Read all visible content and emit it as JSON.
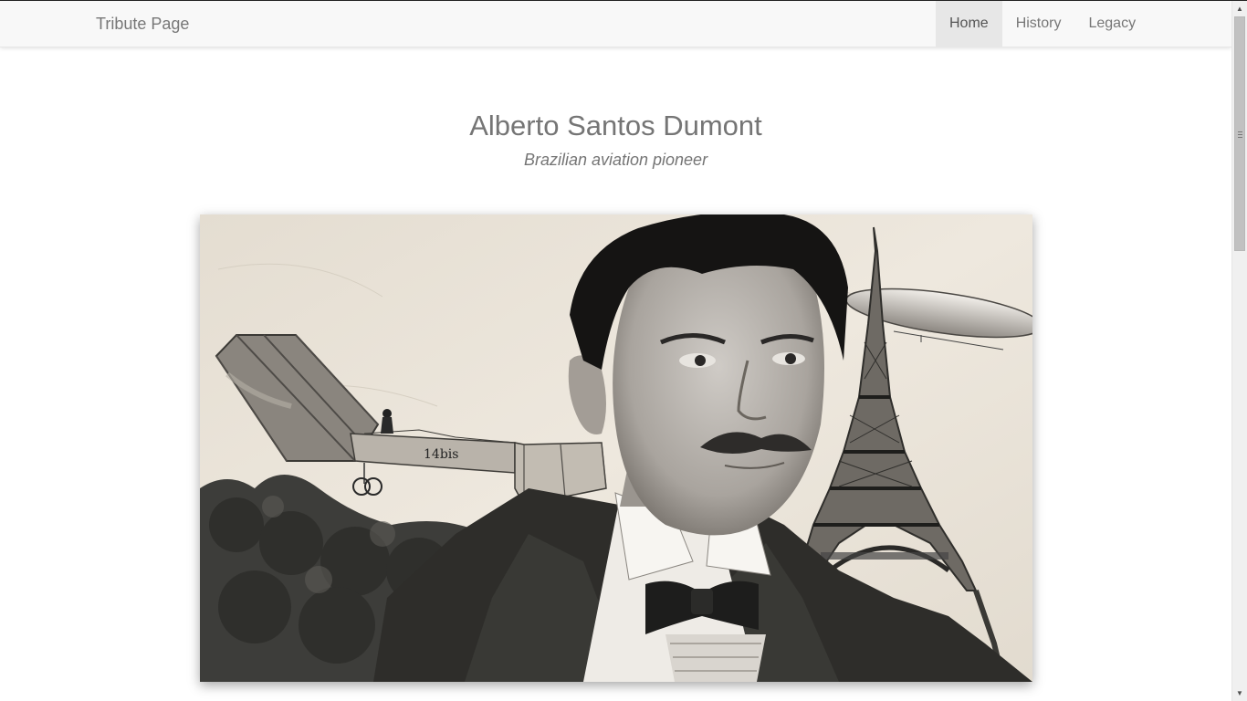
{
  "navbar": {
    "brand": "Tribute Page",
    "items": [
      {
        "label": "Home",
        "active": true
      },
      {
        "label": "History",
        "active": false
      },
      {
        "label": "Legacy",
        "active": false
      }
    ]
  },
  "header": {
    "title": "Alberto Santos Dumont",
    "subtitle": "Brazilian aviation pioneer"
  },
  "image": {
    "subject": "sepia collage portrait with 14-bis aircraft, airship and Eiffel Tower",
    "plane_marking": "14bis"
  },
  "scrollbar": {
    "up_icon": "triangle-up",
    "down_icon": "triangle-down"
  },
  "colors": {
    "navbar_bg": "#f8f8f8",
    "active_tab_bg": "#e7e7e7",
    "text_muted": "#757575"
  }
}
